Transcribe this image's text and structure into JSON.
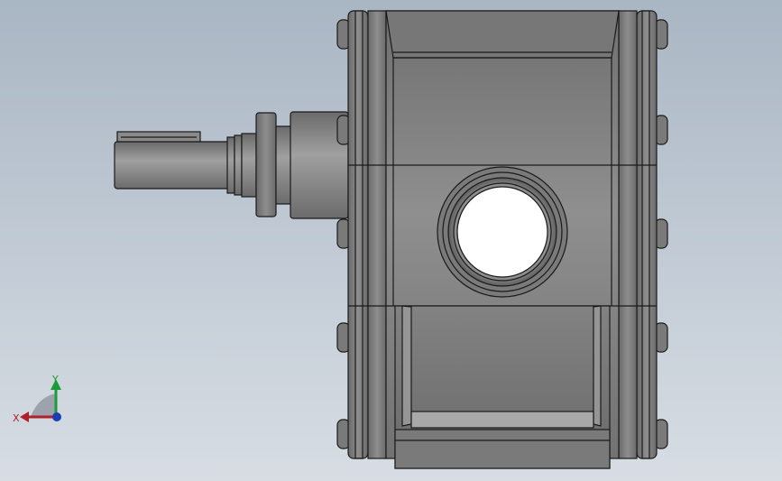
{
  "triad": {
    "x_label": "X",
    "y_label": "Y",
    "colors": {
      "x": "#b0202a",
      "y": "#1e9a3a",
      "z": "#1c3fb0"
    }
  },
  "colors": {
    "background_top": "#a9b6c3",
    "background_bottom": "#d7dde3",
    "body": "#7c7c7c",
    "edge": "#1a1a1a"
  }
}
